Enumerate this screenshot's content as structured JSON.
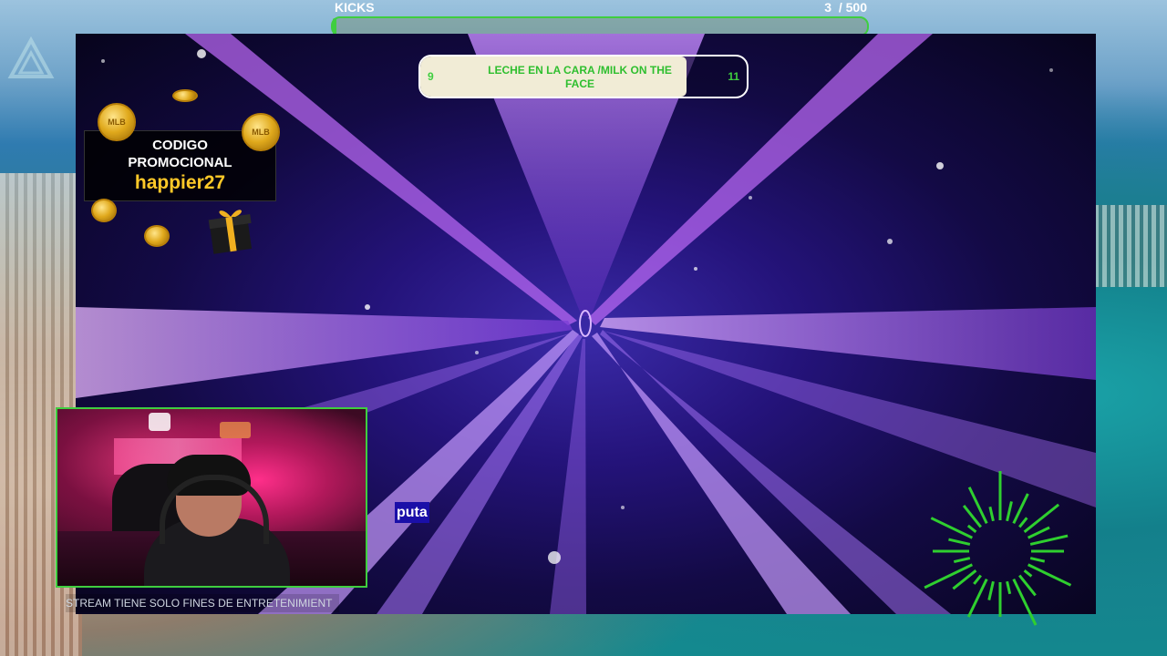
{
  "kicks": {
    "label": "KICKS",
    "count": "3",
    "total": "/ 500",
    "progress_fraction": 0.006,
    "accent_color": "#3fce3f"
  },
  "match": {
    "left_score": "9",
    "title": "LECHE EN LA CARA /MILK ON THE FACE",
    "right_score": "11"
  },
  "promo": {
    "line1": "CODIGO",
    "line2": "PROMOCIONAL",
    "code": "happier27",
    "code_color": "#ffc928"
  },
  "coins": {
    "label": "MLB"
  },
  "caption": {
    "text": "puta"
  },
  "ticker": {
    "text": "STREAM TIENE SOLO FINES DE ENTRETENIMIENT"
  },
  "icons": {
    "brand_logo": "logo-icon",
    "gift": "gift-icon",
    "coin": "coin-icon",
    "burst": "sunburst-icon"
  }
}
